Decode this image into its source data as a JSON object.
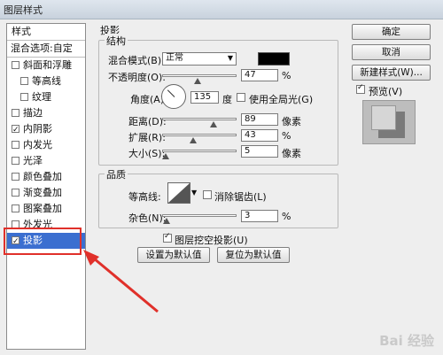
{
  "window": {
    "title": "图层样式"
  },
  "left_panel": {
    "header": "样式",
    "subheader": "混合选项:自定",
    "items": [
      {
        "label": "斜面和浮雕",
        "checked": false,
        "indent": false
      },
      {
        "label": "等高线",
        "checked": false,
        "indent": true
      },
      {
        "label": "纹理",
        "checked": false,
        "indent": true
      },
      {
        "label": "描边",
        "checked": false,
        "indent": false
      },
      {
        "label": "内阴影",
        "checked": true,
        "indent": false
      },
      {
        "label": "内发光",
        "checked": false,
        "indent": false
      },
      {
        "label": "光泽",
        "checked": false,
        "indent": false
      },
      {
        "label": "颜色叠加",
        "checked": false,
        "indent": false
      },
      {
        "label": "渐变叠加",
        "checked": false,
        "indent": false
      },
      {
        "label": "图案叠加",
        "checked": false,
        "indent": false
      },
      {
        "label": "外发光",
        "checked": false,
        "indent": false
      },
      {
        "label": "投影",
        "checked": true,
        "indent": false,
        "selected": true
      }
    ]
  },
  "drop_shadow": {
    "title": "投影",
    "structure": {
      "label": "结构",
      "blend_mode_label": "混合模式(B):",
      "blend_mode_value": "正常",
      "shadow_color": "#000000",
      "opacity_label": "不透明度(O):",
      "opacity_value": "47",
      "opacity_unit": "%",
      "angle_label": "角度(A):",
      "angle_value": "135",
      "angle_unit": "度",
      "global_light_label": "使用全局光(G)",
      "global_light_checked": false,
      "distance_label": "距离(D):",
      "distance_value": "89",
      "distance_unit": "像素",
      "spread_label": "扩展(R):",
      "spread_value": "43",
      "spread_unit": "%",
      "size_label": "大小(S):",
      "size_value": "5",
      "size_unit": "像素"
    },
    "quality": {
      "label": "品质",
      "contour_label": "等高线:",
      "anti_alias_label": "消除锯齿(L)",
      "anti_alias_checked": false,
      "noise_label": "杂色(N):",
      "noise_value": "3",
      "noise_unit": "%"
    },
    "knockout_label": "图层挖空投影(U)",
    "knockout_checked": true,
    "set_default_label": "设置为默认值",
    "reset_default_label": "复位为默认值"
  },
  "right_buttons": {
    "ok": "确定",
    "cancel": "取消",
    "new_style": "新建样式(W)...",
    "preview_label": "预览(V)",
    "preview_checked": true
  },
  "colors": {
    "selection": "#3b6fd0",
    "annotation": "#e0302a"
  },
  "watermark": "Bai 经验"
}
